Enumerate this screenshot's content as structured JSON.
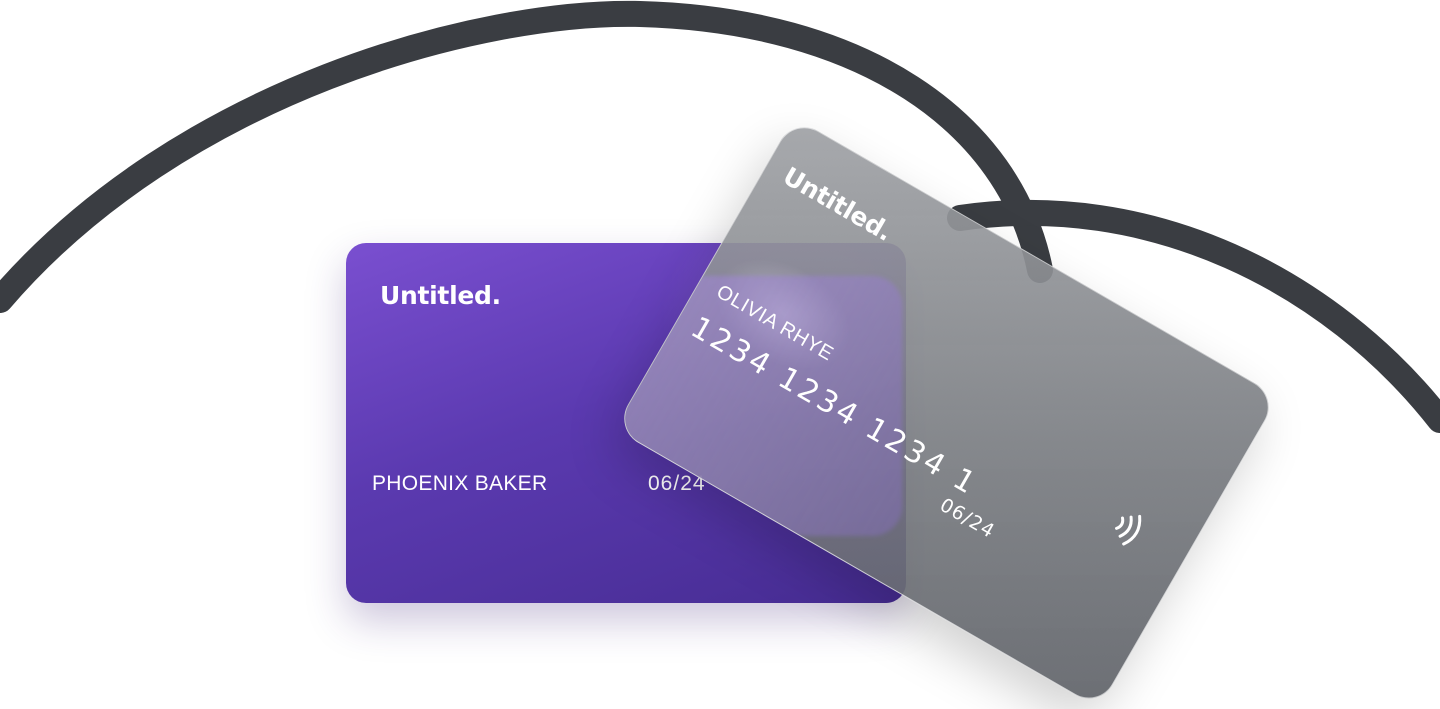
{
  "cards": [
    {
      "brand": "Untitled.",
      "holder": "PHOENIX BAKER",
      "expiry": "06/24"
    },
    {
      "brand": "Untitled.",
      "holder": "OLIVIA RHYE",
      "number": "1234 1234 1234 1",
      "expiry": "06/24",
      "icon": "contactless-icon"
    }
  ],
  "colors": {
    "line": "#3a3d42",
    "purple_card": "#5b3ab0",
    "glass_card": "#7b7e84"
  }
}
